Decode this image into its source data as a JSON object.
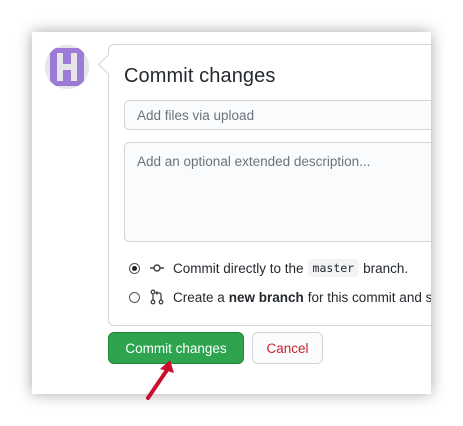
{
  "commit_form": {
    "title": "Commit changes",
    "summary_placeholder": "Add files via upload",
    "description_placeholder": "Add an optional extended description...",
    "option_direct": {
      "prefix": "Commit directly to the",
      "branch": "master",
      "suffix": "branch.",
      "selected": true
    },
    "option_new_branch": {
      "prefix": "Create a",
      "bold": "new branch",
      "suffix": "for this commit and s",
      "selected": false
    }
  },
  "buttons": {
    "commit_label": "Commit changes",
    "cancel_label": "Cancel"
  },
  "colors": {
    "primary_button": "#2ea44f",
    "cancel_text": "#cb2431",
    "avatar": "#9b7bd6",
    "pointer_arrow": "#c8102e"
  },
  "icons": {
    "avatar": "identicon-avatar",
    "commit": "git-commit-icon",
    "pull_request": "git-pull-request-icon",
    "pointer": "red-arrow-pointer"
  }
}
